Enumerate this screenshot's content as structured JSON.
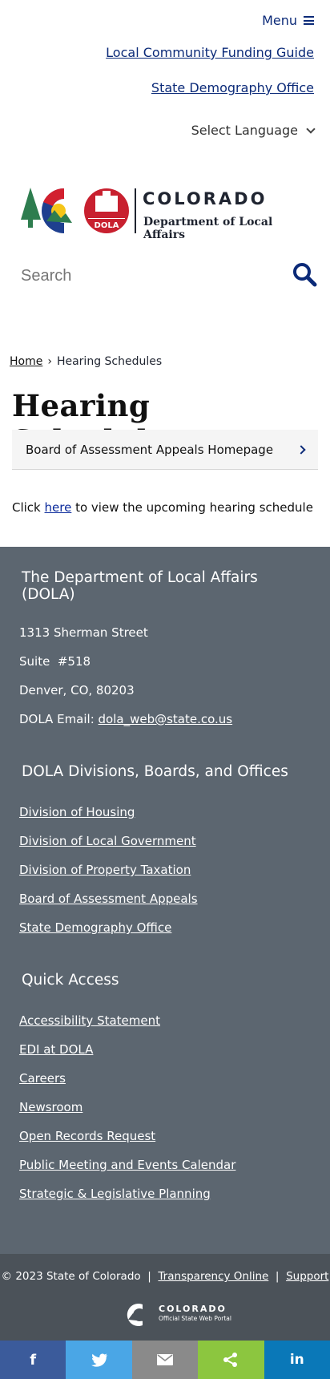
{
  "header": {
    "menu_label": "Menu",
    "top_links": [
      "Local Community Funding Guide",
      "State Demography Office"
    ],
    "language_label": "Select Language"
  },
  "logo": {
    "colorado": "COLORADO",
    "department": "Department of Local Affairs",
    "badge": "DOLA"
  },
  "search": {
    "placeholder": "Search"
  },
  "breadcrumb": {
    "home": "Home",
    "separator": "›",
    "current": "Hearing Schedules"
  },
  "page": {
    "title": "Hearing Schedules",
    "subnav_label": "Board of Assessment Appeals Homepage",
    "body_prefix": "Click ",
    "body_link": "here",
    "body_suffix": " to view the upcoming hearing schedule"
  },
  "footer": {
    "contact_heading_line1": "The Department of Local Affairs",
    "contact_heading_line2": "(DOLA)",
    "address1": "1313 Sherman Street",
    "address2": "Suite  #518",
    "address3": "Denver, CO, 80203",
    "email_label": "DOLA Email: ",
    "email": "dola_web@state.co.us",
    "divisions_heading": "DOLA Divisions, Boards, and Offices",
    "divisions": [
      "Division of Housing",
      "Division of Local Government",
      "Division of Property Taxation",
      "Board of Assessment Appeals",
      "State Demography Office"
    ],
    "quick_heading": "Quick Access",
    "quick": [
      "Accessibility Statement",
      "EDI at DOLA",
      "Careers",
      "Newsroom",
      "Open Records Request",
      "Public Meeting and Events Calendar",
      "Strategic & Legislative Planning"
    ]
  },
  "bottom": {
    "copyright": "© 2023 State of Colorado",
    "sep": "|",
    "transparency": "Transparency Online",
    "support": "Support",
    "portal_title": "COLORADO",
    "portal_sub": "Official State Web Portal"
  },
  "share": {
    "buttons": [
      {
        "name": "facebook",
        "glyph": "f",
        "color": "#3b5b9b"
      },
      {
        "name": "twitter",
        "color": "#4aa6e6"
      },
      {
        "name": "email",
        "color": "#8a8a8a"
      },
      {
        "name": "sharethis",
        "color": "#8cc63f"
      },
      {
        "name": "linkedin",
        "glyph": "in",
        "color": "#0a78b8"
      }
    ]
  },
  "colors": {
    "navy_link": "#0b2a78",
    "footer_bg": "#5c6670",
    "bottom_bg": "#4b5259"
  }
}
